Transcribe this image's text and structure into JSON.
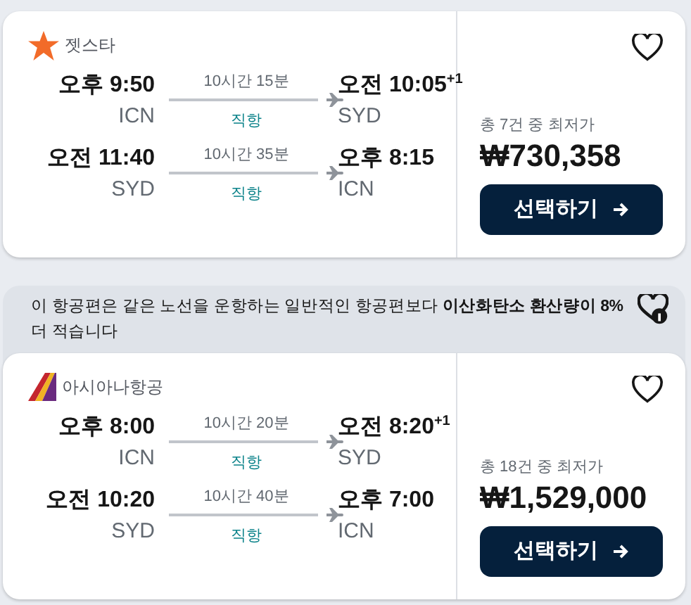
{
  "results": [
    {
      "airline": {
        "name": "젯스타",
        "kind": "star"
      },
      "legs": [
        {
          "dep_time": "오후 9:50",
          "dep_airport": "ICN",
          "duration": "10시간 15분",
          "stops": "직항",
          "arr_time": "오전 10:05",
          "day_offset": "+1",
          "arr_airport": "SYD"
        },
        {
          "dep_time": "오전 11:40",
          "dep_airport": "SYD",
          "duration": "10시간 35분",
          "stops": "직항",
          "arr_time": "오후 8:15",
          "arr_airport": "ICN"
        }
      ],
      "saved": false,
      "price_note": "총 7건 중 최저가",
      "price": "₩730,358",
      "button": "선택하기"
    },
    {
      "eco_note": "이 항공편은 같은 노선을 운항하는 일반적인 항공편보다 **이산화탄소 환산량이 8%** 더 적습니다",
      "airline": {
        "name": "아시아나항공",
        "kind": "stripes"
      },
      "legs": [
        {
          "dep_time": "오후 8:00",
          "dep_airport": "ICN",
          "duration": "10시간 20분",
          "stops": "직항",
          "arr_time": "오전 8:20",
          "day_offset": "+1",
          "arr_airport": "SYD"
        },
        {
          "dep_time": "오전 10:20",
          "dep_airport": "SYD",
          "duration": "10시간 40분",
          "stops": "직항",
          "arr_time": "오후 7:00",
          "arr_airport": "ICN"
        }
      ],
      "saved": false,
      "price_note": "총 18건 중 최저가",
      "price": "₩1,529,000",
      "button": "선택하기"
    }
  ]
}
